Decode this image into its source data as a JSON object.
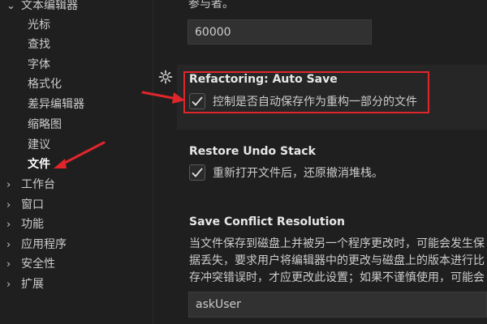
{
  "sidebar": {
    "group_label": "文本编辑器",
    "sub_items": [
      "光标",
      "查找",
      "字体",
      "格式化",
      "差异编辑器",
      "缩略图",
      "建议",
      "文件"
    ],
    "selected_index": 7,
    "top_items": [
      "工作台",
      "窗口",
      "功能",
      "应用程序",
      "安全性",
      "扩展"
    ]
  },
  "settings": {
    "prev_description_tail": "参与者。",
    "prev_value": "60000",
    "auto_save": {
      "category": "Refactoring: ",
      "name": "Auto Save",
      "description": "控制是否自动保存作为重构一部分的文件",
      "checked": true
    },
    "restore_undo": {
      "title": "Restore Undo Stack",
      "description": "重新打开文件后，还原撤消堆栈。",
      "checked": true
    },
    "save_conflict": {
      "title": "Save Conflict Resolution",
      "line1": "当文件保存到磁盘上并被另一个程序更改时，可能会发生保",
      "line2": "据丢失，要求用户将编辑器中的更改与磁盘上的版本进行比",
      "line3": "存冲突错误时，才应更改此设置；如果不谨慎使用，可能会",
      "value": "askUser"
    }
  },
  "colors": {
    "annotation_red": "#e0262b",
    "background": "#1f1f1f",
    "accent_bg": "#262626"
  }
}
